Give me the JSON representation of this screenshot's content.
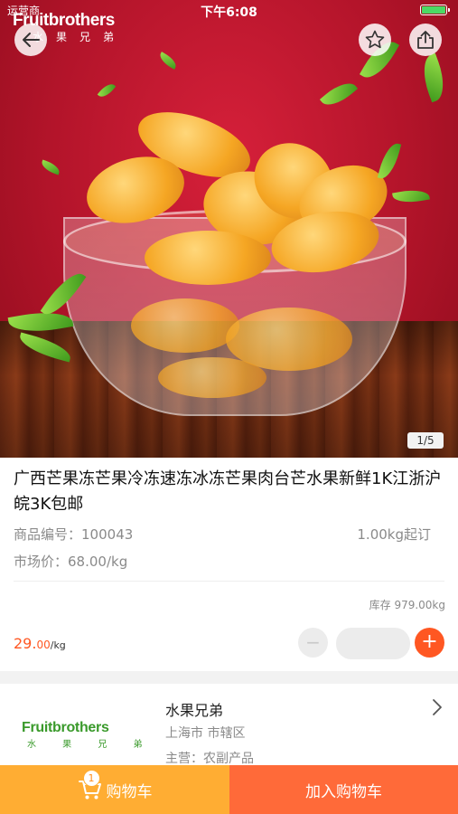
{
  "status": {
    "carrier": "运营商",
    "time": "下午6:08"
  },
  "brand": {
    "en": "Fruitbrothers",
    "cn": "水果兄弟"
  },
  "gallery": {
    "indicator": "1/5"
  },
  "product": {
    "title": "广西芒果冻芒果冷冻速冻冰冻芒果肉台芒水果新鲜1K江浙沪皖3K包邮",
    "code_label": "商品编号：",
    "code": "100043",
    "min_order": "1.00kg起订",
    "market_label": "市场价：",
    "market_price": "68.00/kg",
    "stock": "库存 979.00kg",
    "price_int": "29.",
    "price_dec": "00",
    "price_unit": "/kg",
    "qty_minus": "−",
    "qty_plus": "+"
  },
  "shop": {
    "logo_en": "Fruitbrothers",
    "logo_cn": "水 果 兄 弟",
    "name": "水果兄弟",
    "location": "上海市 市辖区",
    "main": "主营：农副产品"
  },
  "bottom": {
    "cart_label": "购物车",
    "cart_badge": "1",
    "add_label": "加入购物车"
  },
  "colors": {
    "accent": "#ff5722",
    "cart": "#ffad33",
    "add": "#ff6a39",
    "brand_green": "#3a9a2b"
  }
}
